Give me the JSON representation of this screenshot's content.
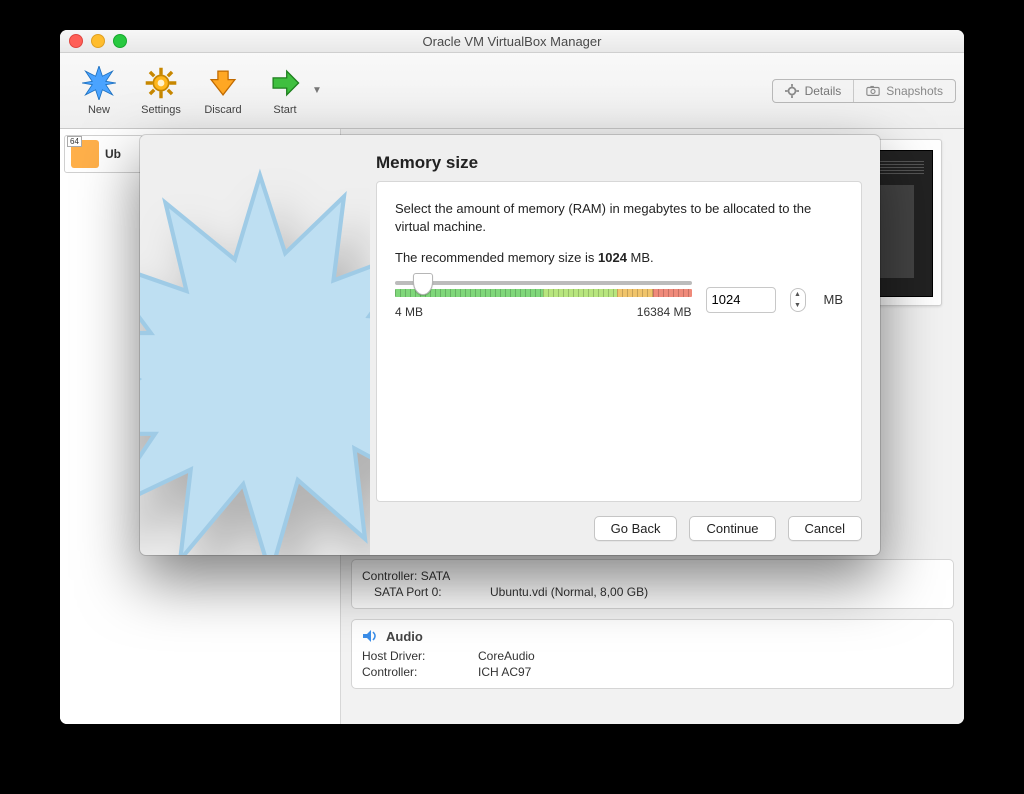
{
  "window": {
    "title": "Oracle VM VirtualBox Manager",
    "traffic": {
      "close": "close",
      "min": "minimize",
      "zoom": "zoom"
    }
  },
  "toolbar": {
    "new": "New",
    "settings": "Settings",
    "discard": "Discard",
    "start": "Start",
    "details": "Details",
    "snapshots": "Snapshots"
  },
  "sidebar": {
    "vm": {
      "name": "Ub",
      "arch_badge": "64"
    }
  },
  "details": {
    "storage": {
      "controller_label": "Controller: SATA",
      "port_label": "SATA Port 0:",
      "port_value": "Ubuntu.vdi (Normal, 8,00 GB)"
    },
    "audio": {
      "header": "Audio",
      "host_label": "Host Driver:",
      "host_value": "CoreAudio",
      "ctrl_label": "Controller:",
      "ctrl_value": "ICH AC97"
    }
  },
  "dialog": {
    "title": "Memory size",
    "body_line1": "Select the amount of memory (RAM) in megabytes to be allocated to the virtual machine.",
    "body_line2_a": "The recommended memory size is ",
    "body_line2_b": "1024",
    "body_line2_c": " MB.",
    "slider": {
      "min_label": "4 MB",
      "max_label": "16384 MB",
      "min": 4,
      "max": 16384,
      "value": 1024,
      "thumb_pct": 6
    },
    "input_value": "1024",
    "unit": "MB",
    "buttons": {
      "back": "Go Back",
      "continue": "Continue",
      "cancel": "Cancel"
    }
  }
}
